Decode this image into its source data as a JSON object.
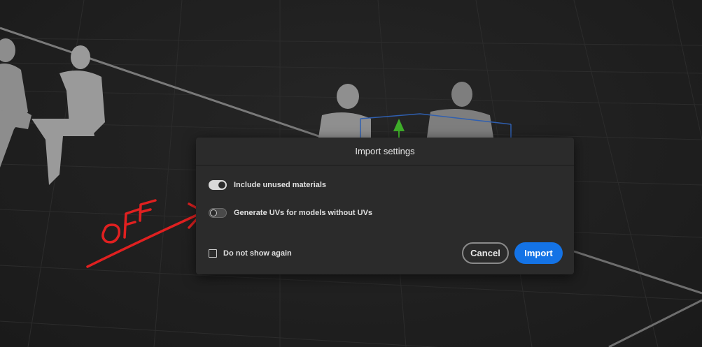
{
  "dialog": {
    "title": "Import settings",
    "options": [
      {
        "label": "Include unused materials",
        "state": "on"
      },
      {
        "label": "Generate UVs for models without UVs",
        "state": "off"
      }
    ],
    "checkbox_label": "Do not show again",
    "cancel_label": "Cancel",
    "import_label": "Import"
  },
  "annotation": {
    "text": "OFF",
    "color": "#e02020"
  },
  "colors": {
    "accent": "#1473e6",
    "dialog_bg": "#2b2b2b",
    "gizmo_green": "#3fae2a",
    "bbox_blue": "#2f5fb0"
  },
  "icons": {
    "toggle_on": "toggle-switch-on",
    "toggle_off": "toggle-switch-off",
    "checkbox": "checkbox-unchecked",
    "gizmo": "move-y-arrow-icon"
  }
}
